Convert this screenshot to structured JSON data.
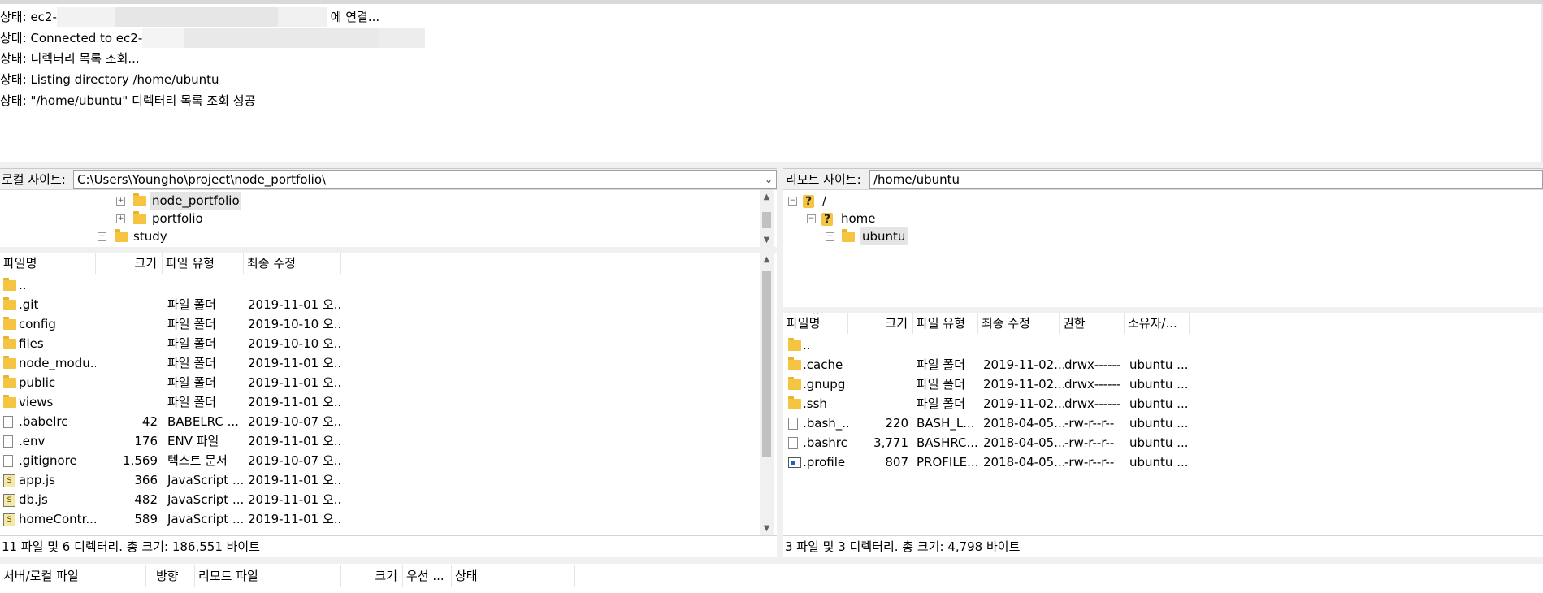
{
  "log": {
    "lines": [
      {
        "prefix": "상태:",
        "text": "ec2-",
        "suffix": "에 연결..."
      },
      {
        "prefix": "상태:",
        "text": "Connected to ec2-"
      },
      {
        "prefix": "상태:",
        "text": "디렉터리 목록 조회..."
      },
      {
        "prefix": "상태:",
        "text": "Listing directory /home/ubuntu"
      },
      {
        "prefix": "상태:",
        "text": "\"/home/ubuntu\" 디렉터리 목록 조회 성공"
      }
    ]
  },
  "local": {
    "label": "로컬 사이트:",
    "path": "C:\\Users\\Youngho\\project\\node_portfolio\\",
    "tree": [
      "node_portfolio",
      "portfolio",
      "study"
    ],
    "columns": {
      "name": "파일명",
      "size": "크기",
      "type": "파일 유형",
      "modified": "최종 수정"
    },
    "files": [
      {
        "name": "..",
        "size": "",
        "type": "",
        "modified": "",
        "icon": "folder-icon"
      },
      {
        "name": ".git",
        "size": "",
        "type": "파일 폴더",
        "modified": "2019-11-01 오...",
        "icon": "folder-icon"
      },
      {
        "name": "config",
        "size": "",
        "type": "파일 폴더",
        "modified": "2019-10-10 오...",
        "icon": "folder-icon"
      },
      {
        "name": "files",
        "size": "",
        "type": "파일 폴더",
        "modified": "2019-10-10 오...",
        "icon": "folder-icon"
      },
      {
        "name": "node_modu...",
        "size": "",
        "type": "파일 폴더",
        "modified": "2019-11-01 오...",
        "icon": "folder-icon"
      },
      {
        "name": "public",
        "size": "",
        "type": "파일 폴더",
        "modified": "2019-11-01 오...",
        "icon": "folder-icon"
      },
      {
        "name": "views",
        "size": "",
        "type": "파일 폴더",
        "modified": "2019-11-01 오...",
        "icon": "folder-icon"
      },
      {
        "name": ".babelrc",
        "size": "42",
        "type": "BABELRC ...",
        "modified": "2019-10-07 오...",
        "icon": "file-icon"
      },
      {
        "name": ".env",
        "size": "176",
        "type": "ENV 파일",
        "modified": "2019-11-01 오...",
        "icon": "file-icon"
      },
      {
        "name": ".gitignore",
        "size": "1,569",
        "type": "텍스트 문서",
        "modified": "2019-10-07 오...",
        "icon": "text-file-icon"
      },
      {
        "name": "app.js",
        "size": "366",
        "type": "JavaScript ...",
        "modified": "2019-11-01 오...",
        "icon": "js-file-icon"
      },
      {
        "name": "db.js",
        "size": "482",
        "type": "JavaScript ...",
        "modified": "2019-11-01 오...",
        "icon": "js-file-icon"
      },
      {
        "name": "homeContr...",
        "size": "589",
        "type": "JavaScript ...",
        "modified": "2019-11-01 오...",
        "icon": "js-file-icon"
      }
    ],
    "status": "11 파일 및 6 디렉터리. 총 크기: 186,551 바이트"
  },
  "remote": {
    "label": "리모트 사이트:",
    "path": "/home/ubuntu",
    "tree": [
      "/",
      "home",
      "ubuntu"
    ],
    "columns": {
      "name": "파일명",
      "size": "크기",
      "type": "파일 유형",
      "modified": "최종 수정",
      "perm": "권한",
      "owner": "소유자/..."
    },
    "files": [
      {
        "name": "..",
        "size": "",
        "type": "",
        "modified": "",
        "perm": "",
        "owner": "",
        "icon": "folder-icon"
      },
      {
        "name": ".cache",
        "size": "",
        "type": "파일 폴더",
        "modified": "2019-11-02...",
        "perm": "drwx------",
        "owner": "ubuntu ...",
        "icon": "folder-icon"
      },
      {
        "name": ".gnupg",
        "size": "",
        "type": "파일 폴더",
        "modified": "2019-11-02...",
        "perm": "drwx------",
        "owner": "ubuntu ...",
        "icon": "folder-icon"
      },
      {
        "name": ".ssh",
        "size": "",
        "type": "파일 폴더",
        "modified": "2019-11-02...",
        "perm": "drwx------",
        "owner": "ubuntu ...",
        "icon": "folder-icon"
      },
      {
        "name": ".bash_...",
        "size": "220",
        "type": "BASH_L...",
        "modified": "2018-04-05...",
        "perm": "-rw-r--r--",
        "owner": "ubuntu ...",
        "icon": "file-icon"
      },
      {
        "name": ".bashrc",
        "size": "3,771",
        "type": "BASHRC...",
        "modified": "2018-04-05...",
        "perm": "-rw-r--r--",
        "owner": "ubuntu ...",
        "icon": "file-icon"
      },
      {
        "name": ".profile",
        "size": "807",
        "type": "PROFILE...",
        "modified": "2018-04-05...",
        "perm": "-rw-r--r--",
        "owner": "ubuntu ...",
        "icon": "profile-file-icon"
      }
    ],
    "status": "3 파일 및 3 디렉터리. 총 크기: 4,798 바이트"
  },
  "queue": {
    "columns": {
      "file": "서버/로컬 파일",
      "direction": "방향",
      "remote": "리모트 파일",
      "size": "크기",
      "priority": "우선 ...",
      "status": "상태"
    }
  }
}
